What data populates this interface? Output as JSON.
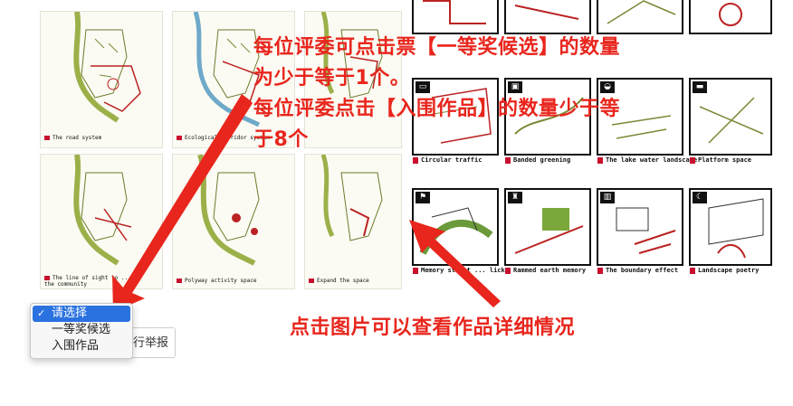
{
  "left_panels": [
    {
      "caption": "The road system"
    },
    {
      "caption": "Ecological corridor system"
    },
    {
      "caption": ""
    },
    {
      "caption": "The line of sight to ... in the community"
    },
    {
      "caption": "Polyway activity space"
    },
    {
      "caption": "Expand the space"
    }
  ],
  "right_tiles_row1": [
    {
      "caption": "Circular traffic",
      "icon": "car-icon"
    },
    {
      "caption": "Banded greening",
      "icon": "bus-icon"
    },
    {
      "caption": "The lake water landscape",
      "icon": "boat-icon"
    },
    {
      "caption": "Platform space",
      "icon": "bench-icon"
    }
  ],
  "right_tiles_row2": [
    {
      "caption": "Memory street ... lick",
      "icon": "flag-icon"
    },
    {
      "caption": "Rammed earth memory",
      "icon": "tower-icon"
    },
    {
      "caption": "The boundary effect",
      "icon": "building-icon"
    },
    {
      "caption": "Landscape poetry",
      "icon": "moon-icon"
    }
  ],
  "annotations": {
    "line1": "每位评委可点击票【一等奖候选】的数量",
    "line2": "为少于等于1个。",
    "line3": "每位评委点击【入围作品】的数量少于等",
    "line4": "于8个",
    "click_hint": "点击图片可以查看作品详细情况"
  },
  "report_button": {
    "label": "行举报"
  },
  "dropdown": {
    "options": [
      "请选择",
      "一等奖候选",
      "入围作品"
    ],
    "selected_index": 0,
    "check": "✓"
  },
  "colors": {
    "annotation_red": "#e8261d",
    "select_blue": "#2a72e0",
    "caption_marker": "#c8102e"
  }
}
